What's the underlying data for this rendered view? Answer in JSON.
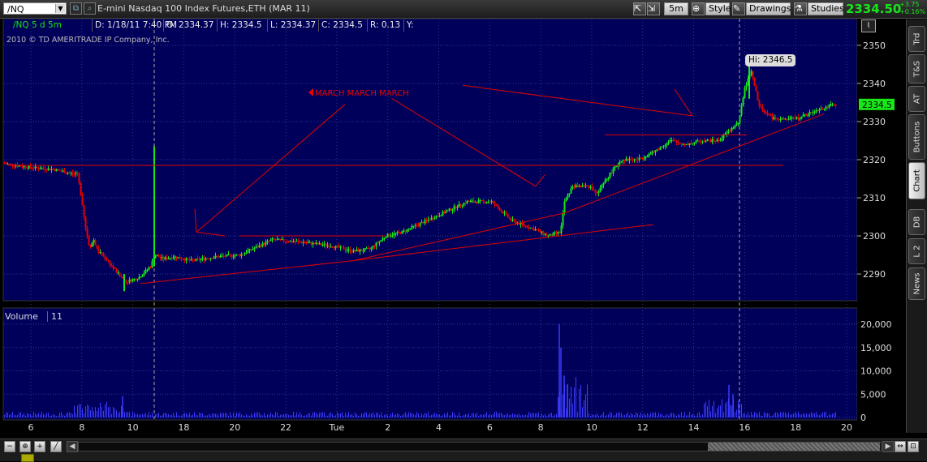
{
  "toolbar": {
    "symbol": "/NQ",
    "instrument": "E-mini Nasdaq 100 Index Futures,ETH (MAR 11)",
    "timeframe": "5m",
    "style_label": "Style",
    "drawings_label": "Drawings",
    "studies_label": "Studies",
    "last_price": "2334.50",
    "change": "+3.75",
    "change_pct": "+0.16%"
  },
  "side_tabs": [
    "Trd",
    "T&S",
    "AT",
    "Buttons",
    "Chart",
    "DB",
    "L 2",
    "News"
  ],
  "info_row": {
    "ticker": "/NQ 5 d 5m",
    "date": "D: 1/18/11 7:40 PM",
    "open": "O: 2334.37",
    "high": "H: 2334.5",
    "low": "L: 2334.37",
    "close": "C: 2334.5",
    "range": "R: 0.13",
    "y": "Y:"
  },
  "copyright": "2010 © TD AMERITRADE IP Company, Inc.",
  "hi_label": "Hi: 2346.5",
  "annotation": "MARCH MARCH MARCH",
  "volume_label": "Volume",
  "volume_value": "11",
  "colors": {
    "up": "#19e619",
    "down": "#e60000",
    "background": "#00005a",
    "grid": "#2a3a8a",
    "trendline": "#e00000",
    "volume": "#3b3bff"
  },
  "chart_data": [
    {
      "type": "candlestick",
      "ylim": [
        2283,
        2357
      ],
      "y_ticks": [
        2290,
        2300,
        2310,
        2320,
        2330,
        2340,
        2350
      ],
      "x_tick_labels": [
        "6",
        "8",
        "10",
        "18",
        "20",
        "22",
        "Tue",
        "2",
        "4",
        "6",
        "8",
        "10",
        "12",
        "14",
        "16",
        "18",
        "20"
      ],
      "last_price_marker": "2334.5",
      "high": 2346.5,
      "close_path": [
        [
          0,
          2319
        ],
        [
          30,
          2318
        ],
        [
          60,
          2317.5
        ],
        [
          90,
          2316
        ],
        [
          95,
          2310
        ],
        [
          100,
          2302
        ],
        [
          105,
          2297
        ],
        [
          110,
          2299
        ],
        [
          115,
          2296
        ],
        [
          125,
          2294
        ],
        [
          140,
          2290
        ],
        [
          150,
          2288
        ],
        [
          165,
          2289
        ],
        [
          180,
          2292
        ],
        [
          185,
          2295
        ],
        [
          195,
          2294
        ],
        [
          210,
          2294.5
        ],
        [
          230,
          2293.5
        ],
        [
          260,
          2294.5
        ],
        [
          290,
          2295
        ],
        [
          310,
          2297
        ],
        [
          330,
          2299
        ],
        [
          360,
          2298.5
        ],
        [
          400,
          2297.5
        ],
        [
          430,
          2296
        ],
        [
          450,
          2296.5
        ],
        [
          470,
          2300
        ],
        [
          490,
          2301
        ],
        [
          520,
          2304
        ],
        [
          550,
          2307
        ],
        [
          570,
          2309
        ],
        [
          600,
          2309
        ],
        [
          610,
          2307
        ],
        [
          625,
          2304
        ],
        [
          650,
          2302
        ],
        [
          670,
          2300
        ],
        [
          685,
          2301
        ],
        [
          690,
          2309
        ],
        [
          700,
          2313
        ],
        [
          720,
          2313
        ],
        [
          730,
          2311
        ],
        [
          745,
          2316
        ],
        [
          760,
          2320
        ],
        [
          780,
          2320
        ],
        [
          800,
          2322
        ],
        [
          820,
          2325
        ],
        [
          840,
          2324
        ],
        [
          860,
          2325
        ],
        [
          880,
          2325
        ],
        [
          895,
          2328
        ],
        [
          905,
          2330
        ],
        [
          912,
          2339
        ],
        [
          920,
          2343
        ],
        [
          930,
          2334
        ],
        [
          945,
          2331
        ],
        [
          960,
          2330.5
        ],
        [
          980,
          2331
        ],
        [
          1000,
          2333
        ],
        [
          1015,
          2334
        ],
        [
          1025,
          2334.5
        ]
      ],
      "spikes": [
        {
          "x": 185,
          "high": 2323.5,
          "low": 2292
        },
        {
          "x": 148,
          "high": 2290,
          "low": 2285.5
        },
        {
          "x": 918,
          "high": 2346.5,
          "low": 2336
        }
      ],
      "trend_lines": [
        [
          [
            5,
            2318.5
          ],
          [
            960,
            2318.5
          ]
        ],
        [
          [
            168,
            2287.5
          ],
          [
            430,
            2293.5
          ],
          [
            690,
            2306
          ],
          [
            1010,
            2332
          ]
        ],
        [
          [
            430,
            2293.5
          ],
          [
            800,
            2303
          ]
        ],
        [
          [
            290,
            2300
          ],
          [
            470,
            2300
          ]
        ],
        [
          [
            740,
            2326.5
          ],
          [
            915,
            2326.5
          ]
        ],
        [
          [
            237,
            2301
          ],
          [
            272,
            2300
          ]
        ],
        [
          [
            237,
            2301
          ],
          [
            235,
            2307
          ]
        ],
        [
          [
            237,
            2301
          ],
          [
            420,
            2334.5
          ]
        ],
        [
          [
            478,
            2336
          ],
          [
            655,
            2313
          ]
        ],
        [
          [
            655,
            2313
          ],
          [
            666,
            2316
          ]
        ],
        [
          [
            565,
            2339.5
          ],
          [
            848,
            2331.5
          ]
        ],
        [
          [
            848,
            2331.5
          ],
          [
            826,
            2338.5
          ]
        ]
      ],
      "vertical_markers": [
        185,
        906
      ]
    },
    {
      "type": "bar",
      "title": "Volume",
      "ylim": [
        0,
        20000
      ],
      "y_ticks": [
        "0",
        "5,000",
        "10,000",
        "15,000",
        "20,000"
      ]
    }
  ]
}
